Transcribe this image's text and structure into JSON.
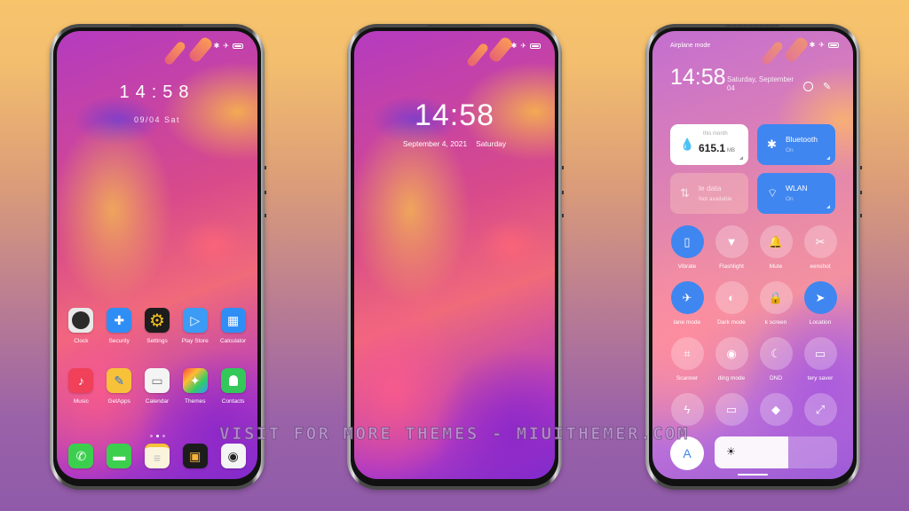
{
  "watermark": "VISIT FOR MORE THEMES - MIUITHEMER.COM",
  "status_bar": {
    "icons": [
      "bluetooth-icon",
      "airplane-icon",
      "battery-icon"
    ],
    "bluetooth_glyph": "✱",
    "airplane_glyph": "✈"
  },
  "home_screen": {
    "time": "14:58",
    "date": "09/04 Sat",
    "row1": [
      {
        "label": "Clock",
        "icon": "clock-icon",
        "glyph": "◷",
        "color": "#e9e9e9"
      },
      {
        "label": "Security",
        "icon": "shield-icon",
        "glyph": "✚",
        "color": "#2f8ef5"
      },
      {
        "label": "Settings",
        "icon": "gear-icon",
        "glyph": "⚙",
        "color": "#1d1d1d"
      },
      {
        "label": "Play Store",
        "icon": "play-store-icon",
        "glyph": "▷",
        "color": "#3b9bf5"
      },
      {
        "label": "Calculator",
        "icon": "calculator-icon",
        "glyph": "▦",
        "color": "#2f8ef5"
      }
    ],
    "row2": [
      {
        "label": "Music",
        "icon": "music-icon",
        "glyph": "♪",
        "color": "#f0405a"
      },
      {
        "label": "GetApps",
        "icon": "getapps-icon",
        "glyph": "✎",
        "color": "#f7c23a"
      },
      {
        "label": "Calendar",
        "icon": "calendar-icon",
        "glyph": "▭",
        "color": "#f4f4f4"
      },
      {
        "label": "Themes",
        "icon": "themes-brush-icon",
        "glyph": "✦",
        "color": "#ee6b3a"
      },
      {
        "label": "Contacts",
        "icon": "contacts-icon",
        "glyph": "👤",
        "color": "#34c759"
      }
    ],
    "dock": [
      {
        "icon": "phone-icon",
        "glyph": "✆",
        "color": "#3ccf4e"
      },
      {
        "icon": "messages-icon",
        "glyph": "▬",
        "color": "#3ccf4e"
      },
      {
        "icon": "notes-icon",
        "glyph": "≡",
        "color": "#fbf4dc"
      },
      {
        "icon": "gallery-icon",
        "glyph": "▣",
        "color": "#1c1c1c"
      },
      {
        "icon": "camera-icon",
        "glyph": "◉",
        "color": "#f4f4f4"
      }
    ],
    "page_count": 3,
    "current_page": 2
  },
  "lock_screen": {
    "time": "14:58",
    "date": "September 4, 2021",
    "weekday": "Saturday"
  },
  "control_center": {
    "airplane_label": "Airplane mode",
    "time": "14:58",
    "date": "Saturday, September 04",
    "data_tile": {
      "caption": "this month",
      "value": "615.1",
      "unit": "MB"
    },
    "bluetooth_tile": {
      "title": "Bluetooth",
      "state": "On"
    },
    "mobile_data_tile": {
      "title": "le data",
      "state": "Not available"
    },
    "wlan_tile": {
      "title": "WLAN",
      "state": "On"
    },
    "toggles": [
      {
        "label": "Vibrate",
        "icon": "vibrate-icon",
        "glyph": "▯",
        "on": true
      },
      {
        "label": "Flashlight",
        "icon": "flashlight-icon",
        "glyph": "▼",
        "on": false
      },
      {
        "label": "Mute",
        "icon": "bell-icon",
        "glyph": "🔔",
        "on": false
      },
      {
        "label": "eenshot",
        "icon": "screenshot-scissors-icon",
        "glyph": "✂",
        "on": false
      },
      {
        "label": "lane mode",
        "icon": "airplane-icon",
        "glyph": "✈",
        "on": true
      },
      {
        "label": "Dark mode",
        "icon": "dark-mode-icon",
        "glyph": "◐",
        "on": false
      },
      {
        "label": "k screen",
        "icon": "lock-icon",
        "glyph": "🔒",
        "on": false
      },
      {
        "label": "Location",
        "icon": "location-arrow-icon",
        "glyph": "➤",
        "on": true
      },
      {
        "label": "Scanner",
        "icon": "scanner-icon",
        "glyph": "⌗",
        "on": false
      },
      {
        "label": "ding mode",
        "icon": "eye-icon",
        "glyph": "◉",
        "on": false
      },
      {
        "label": "DND",
        "icon": "moon-icon",
        "glyph": "☾",
        "on": false
      },
      {
        "label": "tery saver",
        "icon": "battery-saver-icon",
        "glyph": "▭",
        "on": false
      },
      {
        "label": "",
        "icon": "lightning-icon",
        "glyph": "ϟ",
        "on": false
      },
      {
        "label": "",
        "icon": "cast-screen-icon",
        "glyph": "▭",
        "on": false
      },
      {
        "label": "",
        "icon": "link-icon",
        "glyph": "◆",
        "on": false
      },
      {
        "label": "",
        "icon": "expand-icon",
        "glyph": "⤢",
        "on": false
      }
    ],
    "auto_brightness_label": "A",
    "brightness_level": 0.6
  },
  "accent_color": "#3f86f0"
}
